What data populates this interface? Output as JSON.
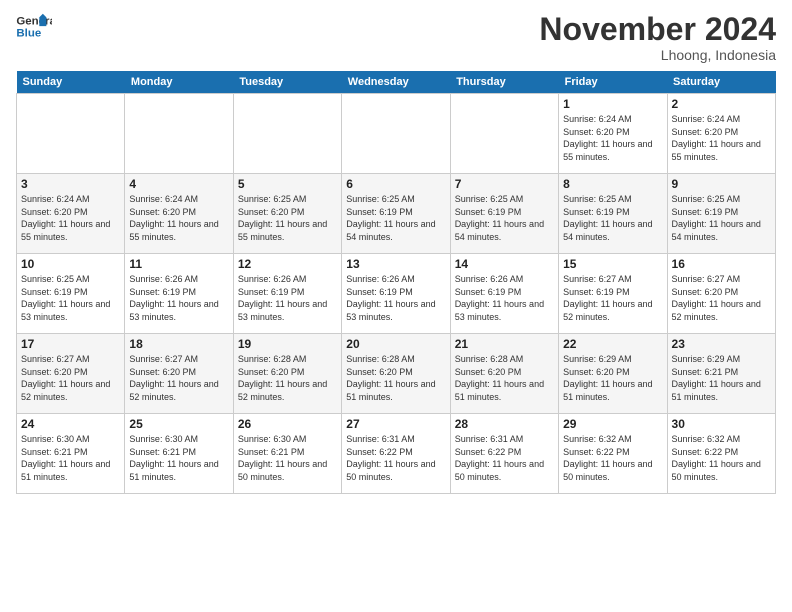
{
  "header": {
    "logo_line1": "General",
    "logo_line2": "Blue",
    "month": "November 2024",
    "location": "Lhoong, Indonesia"
  },
  "weekdays": [
    "Sunday",
    "Monday",
    "Tuesday",
    "Wednesday",
    "Thursday",
    "Friday",
    "Saturday"
  ],
  "weeks": [
    [
      {
        "day": "",
        "info": ""
      },
      {
        "day": "",
        "info": ""
      },
      {
        "day": "",
        "info": ""
      },
      {
        "day": "",
        "info": ""
      },
      {
        "day": "",
        "info": ""
      },
      {
        "day": "1",
        "info": "Sunrise: 6:24 AM\nSunset: 6:20 PM\nDaylight: 11 hours and 55 minutes."
      },
      {
        "day": "2",
        "info": "Sunrise: 6:24 AM\nSunset: 6:20 PM\nDaylight: 11 hours and 55 minutes."
      }
    ],
    [
      {
        "day": "3",
        "info": "Sunrise: 6:24 AM\nSunset: 6:20 PM\nDaylight: 11 hours and 55 minutes."
      },
      {
        "day": "4",
        "info": "Sunrise: 6:24 AM\nSunset: 6:20 PM\nDaylight: 11 hours and 55 minutes."
      },
      {
        "day": "5",
        "info": "Sunrise: 6:25 AM\nSunset: 6:20 PM\nDaylight: 11 hours and 55 minutes."
      },
      {
        "day": "6",
        "info": "Sunrise: 6:25 AM\nSunset: 6:19 PM\nDaylight: 11 hours and 54 minutes."
      },
      {
        "day": "7",
        "info": "Sunrise: 6:25 AM\nSunset: 6:19 PM\nDaylight: 11 hours and 54 minutes."
      },
      {
        "day": "8",
        "info": "Sunrise: 6:25 AM\nSunset: 6:19 PM\nDaylight: 11 hours and 54 minutes."
      },
      {
        "day": "9",
        "info": "Sunrise: 6:25 AM\nSunset: 6:19 PM\nDaylight: 11 hours and 54 minutes."
      }
    ],
    [
      {
        "day": "10",
        "info": "Sunrise: 6:25 AM\nSunset: 6:19 PM\nDaylight: 11 hours and 53 minutes."
      },
      {
        "day": "11",
        "info": "Sunrise: 6:26 AM\nSunset: 6:19 PM\nDaylight: 11 hours and 53 minutes."
      },
      {
        "day": "12",
        "info": "Sunrise: 6:26 AM\nSunset: 6:19 PM\nDaylight: 11 hours and 53 minutes."
      },
      {
        "day": "13",
        "info": "Sunrise: 6:26 AM\nSunset: 6:19 PM\nDaylight: 11 hours and 53 minutes."
      },
      {
        "day": "14",
        "info": "Sunrise: 6:26 AM\nSunset: 6:19 PM\nDaylight: 11 hours and 53 minutes."
      },
      {
        "day": "15",
        "info": "Sunrise: 6:27 AM\nSunset: 6:19 PM\nDaylight: 11 hours and 52 minutes."
      },
      {
        "day": "16",
        "info": "Sunrise: 6:27 AM\nSunset: 6:20 PM\nDaylight: 11 hours and 52 minutes."
      }
    ],
    [
      {
        "day": "17",
        "info": "Sunrise: 6:27 AM\nSunset: 6:20 PM\nDaylight: 11 hours and 52 minutes."
      },
      {
        "day": "18",
        "info": "Sunrise: 6:27 AM\nSunset: 6:20 PM\nDaylight: 11 hours and 52 minutes."
      },
      {
        "day": "19",
        "info": "Sunrise: 6:28 AM\nSunset: 6:20 PM\nDaylight: 11 hours and 52 minutes."
      },
      {
        "day": "20",
        "info": "Sunrise: 6:28 AM\nSunset: 6:20 PM\nDaylight: 11 hours and 51 minutes."
      },
      {
        "day": "21",
        "info": "Sunrise: 6:28 AM\nSunset: 6:20 PM\nDaylight: 11 hours and 51 minutes."
      },
      {
        "day": "22",
        "info": "Sunrise: 6:29 AM\nSunset: 6:20 PM\nDaylight: 11 hours and 51 minutes."
      },
      {
        "day": "23",
        "info": "Sunrise: 6:29 AM\nSunset: 6:21 PM\nDaylight: 11 hours and 51 minutes."
      }
    ],
    [
      {
        "day": "24",
        "info": "Sunrise: 6:30 AM\nSunset: 6:21 PM\nDaylight: 11 hours and 51 minutes."
      },
      {
        "day": "25",
        "info": "Sunrise: 6:30 AM\nSunset: 6:21 PM\nDaylight: 11 hours and 51 minutes."
      },
      {
        "day": "26",
        "info": "Sunrise: 6:30 AM\nSunset: 6:21 PM\nDaylight: 11 hours and 50 minutes."
      },
      {
        "day": "27",
        "info": "Sunrise: 6:31 AM\nSunset: 6:22 PM\nDaylight: 11 hours and 50 minutes."
      },
      {
        "day": "28",
        "info": "Sunrise: 6:31 AM\nSunset: 6:22 PM\nDaylight: 11 hours and 50 minutes."
      },
      {
        "day": "29",
        "info": "Sunrise: 6:32 AM\nSunset: 6:22 PM\nDaylight: 11 hours and 50 minutes."
      },
      {
        "day": "30",
        "info": "Sunrise: 6:32 AM\nSunset: 6:22 PM\nDaylight: 11 hours and 50 minutes."
      }
    ]
  ]
}
